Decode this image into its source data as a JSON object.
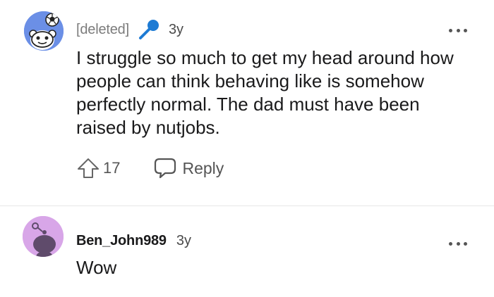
{
  "comments": [
    {
      "author": "[deleted]",
      "time": "3y",
      "body": "I struggle so much to get my head around how\npeople can think behaving like is somehow\nperfectly normal. The dad must have been\nraised by nutjobs.",
      "votes": "17",
      "reply_label": "Reply",
      "avatar_icon": "snoo-soccer-avatar",
      "badge_icon": "microphone-icon",
      "avatar_color": "#6b8fe6",
      "badge_color": "#1e7bd4"
    },
    {
      "author": "Ben_John989",
      "time": "3y",
      "body": "Wow",
      "avatar_icon": "snoo-avatar",
      "avatar_color": "#d8a6e8"
    }
  ]
}
